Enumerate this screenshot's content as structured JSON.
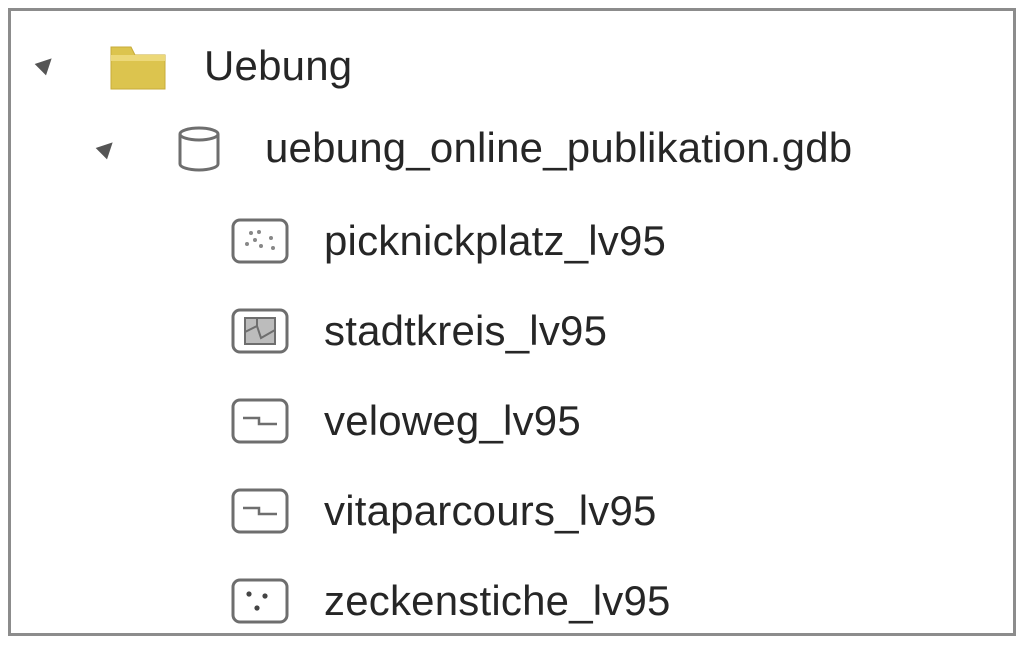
{
  "tree": {
    "folder": {
      "label": "Uebung",
      "icon": "folder-icon",
      "expanded": true
    },
    "geodatabase": {
      "label": "uebung_online_publikation.gdb",
      "icon": "database-icon",
      "expanded": true
    },
    "feature_classes": [
      {
        "label": "picknickplatz_lv95",
        "icon": "multipoint-feature-icon"
      },
      {
        "label": "stadtkreis_lv95",
        "icon": "polygon-feature-icon"
      },
      {
        "label": "veloweg_lv95",
        "icon": "polyline-feature-icon"
      },
      {
        "label": "vitaparcours_lv95",
        "icon": "polyline-feature-icon"
      },
      {
        "label": "zeckenstiche_lv95",
        "icon": "point-feature-icon"
      }
    ]
  },
  "colors": {
    "folder_yellow": "#dcc44e",
    "icon_gray": "#6e6e6e",
    "text": "#262626",
    "border": "#8c8c8c"
  }
}
